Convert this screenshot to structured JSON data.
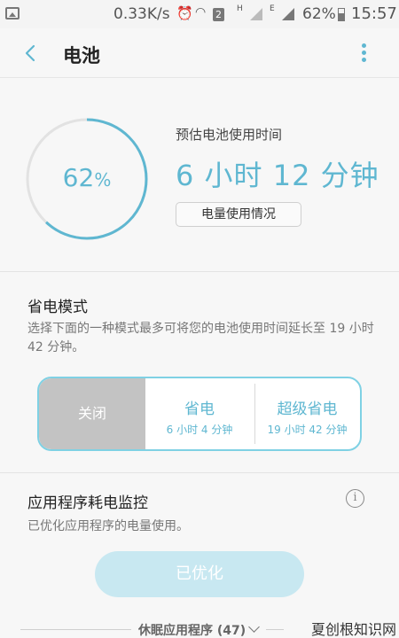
{
  "status_bar": {
    "speed": "0.33K/s",
    "sim_badge": "2",
    "signal1_label": "H",
    "signal2_label": "E",
    "battery_percent": "62%",
    "time": "15:57"
  },
  "app_bar": {
    "title": "电池"
  },
  "battery": {
    "level_value": "62",
    "level_unit": "%",
    "level_fraction": 0.62,
    "estimate_label": "预估电池使用时间",
    "estimate_time": "6 小时 12 分钟",
    "usage_button": "电量使用情况",
    "colors": {
      "accent": "#5fb7d1",
      "track": "#e2e2e2"
    }
  },
  "power_saving": {
    "title": "省电模式",
    "description": "选择下面的一种模式最多可将您的电池使用时间延长至 19 小时 42 分钟。",
    "modes": [
      {
        "name": "关闭",
        "sub": "",
        "selected": true
      },
      {
        "name": "省电",
        "sub": "6 小时 4 分钟",
        "selected": false
      },
      {
        "name": "超级省电",
        "sub": "19 小时 42 分钟",
        "selected": false
      }
    ]
  },
  "app_monitor": {
    "title": "应用程序耗电监控",
    "description": "已优化应用程序的电量使用。",
    "info_icon": "i",
    "optimized_button": "已优化",
    "sleeping_apps": "休眠应用程序 (47)"
  },
  "watermark": "夏创根知识网"
}
